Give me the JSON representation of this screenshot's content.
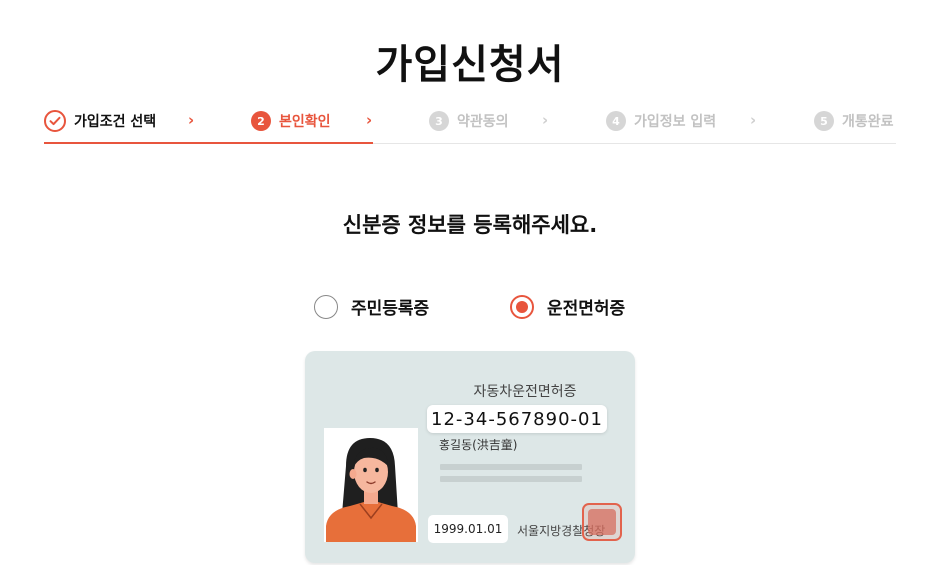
{
  "page": {
    "title": "가입신청서"
  },
  "stepper": {
    "steps": [
      {
        "number": "",
        "label": "가입조건 선택",
        "state": "done"
      },
      {
        "number": "2",
        "label": "본인확인",
        "state": "active"
      },
      {
        "number": "3",
        "label": "약관동의",
        "state": "pending"
      },
      {
        "number": "4",
        "label": "가입정보 입력",
        "state": "pending"
      },
      {
        "number": "5",
        "label": "개통완료",
        "state": "pending"
      }
    ],
    "separator": "›",
    "accent_color": "#e8553d"
  },
  "main": {
    "subtitle": "신분증 정보를 등록해주세요.",
    "id_type": {
      "options": [
        "주민등록증",
        "운전면허증"
      ],
      "selected": "운전면허증"
    },
    "card": {
      "title": "자동차운전면허증",
      "number": "12-34-567890-01",
      "name": "홍길동(洪吉童)",
      "date": "1999.01.01",
      "issuer": "서울지방경찰청장"
    }
  }
}
